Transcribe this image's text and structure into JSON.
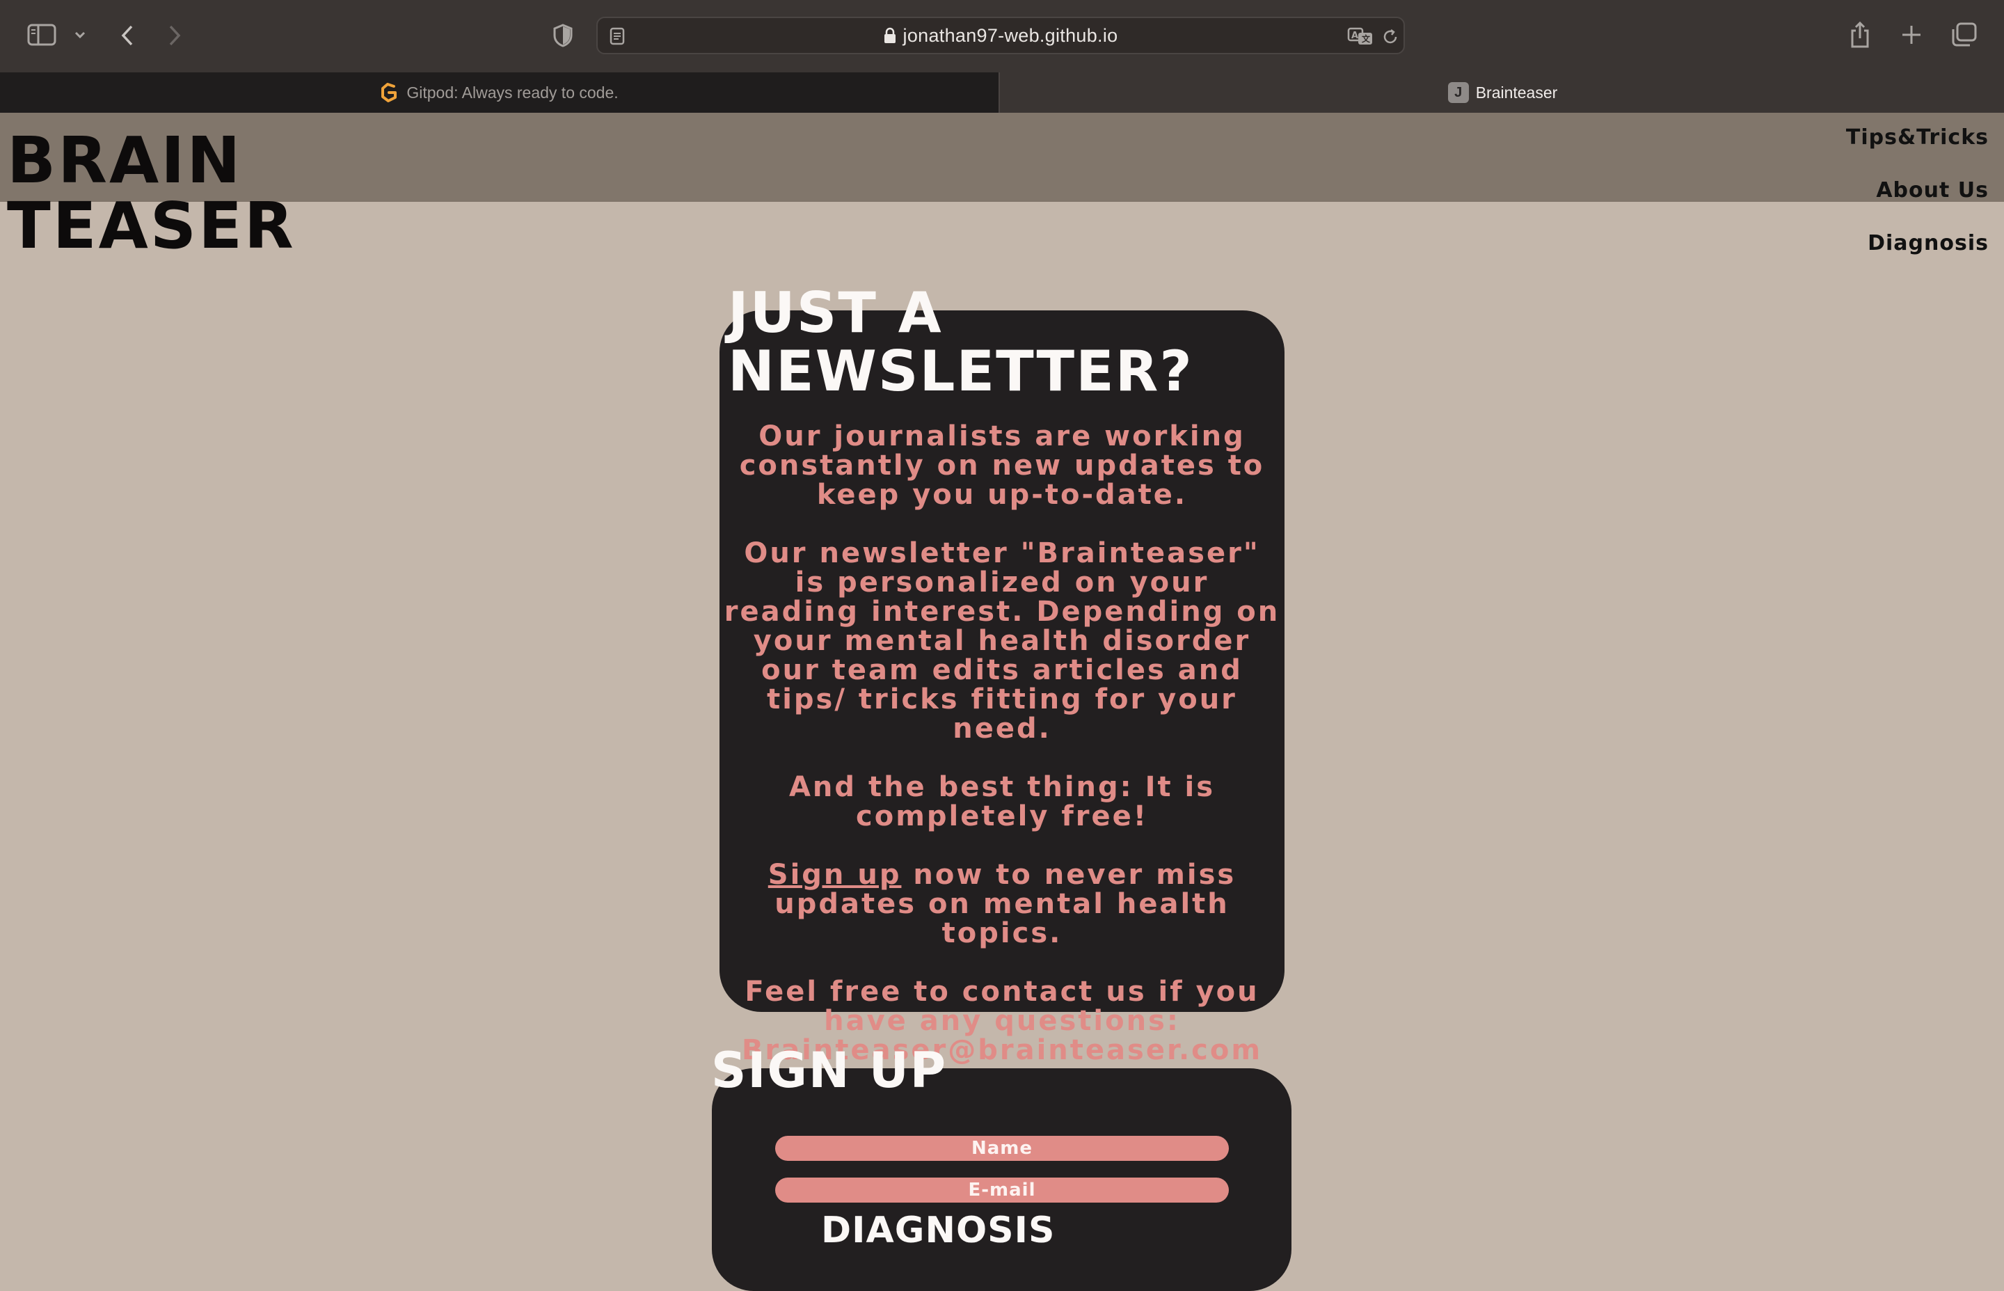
{
  "browser": {
    "url": "jonathan97-web.github.io",
    "tabs": [
      {
        "label": "Gitpod: Always ready to code.",
        "icon": "gitpod-icon",
        "active": false
      },
      {
        "label": "Brainteaser",
        "icon": "j-favicon-icon",
        "favicon_letter": "J",
        "active": true
      }
    ]
  },
  "site": {
    "logo": {
      "line1": "BRAIN",
      "line2": "TEASER"
    },
    "nav": [
      {
        "label": "Tips&Tricks"
      },
      {
        "label": "About Us"
      },
      {
        "label": "Diagnosis"
      }
    ],
    "newsletter": {
      "title_line1": "JUST A",
      "title_line2": "NEWSLETTER?",
      "paragraphs": [
        "Our journalists are working constantly on new updates to keep you up-to-date.",
        "Our newsletter \"Brainteaser\" is personalized on your reading interest. Depending on your mental health disorder our team edits articles and tips/ tricks fitting for your need.",
        "And the best thing: It is completely free!"
      ],
      "signup_link": "Sign up",
      "signup_rest": " now to never miss updates on mental health topics.",
      "contact": "Feel free to contact us if you have any questions: Brainteaser@brainteaser.com"
    },
    "signup": {
      "title": "SIGN UP",
      "name_placeholder": "Name",
      "email_placeholder": "E-mail",
      "diagnosis_label": "DIAGNOSIS"
    }
  },
  "colors": {
    "page_bg": "#c4b7ab",
    "header_bg": "#81766b",
    "card_bg": "#221f20",
    "accent": "#e08c87"
  }
}
